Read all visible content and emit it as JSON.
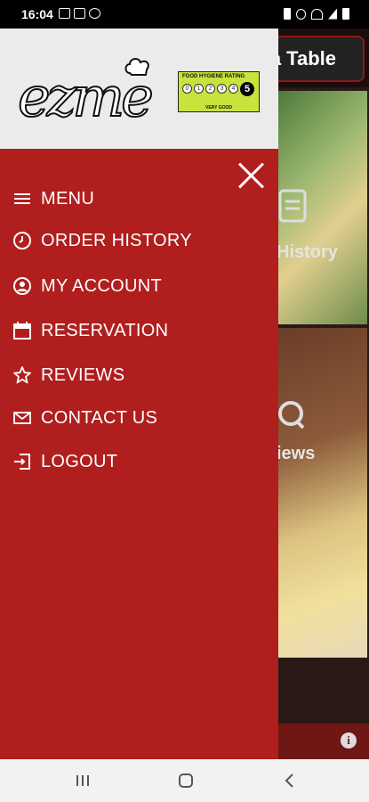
{
  "status_bar": {
    "time": "16:04"
  },
  "background": {
    "header_button": "a Table",
    "tile_history_label": "History",
    "tile_reviews_label": "iews"
  },
  "drawer": {
    "logo_text": "ezme",
    "hygiene_rating": {
      "title": "FOOD HYGIENE RATING",
      "scale": [
        "0",
        "1",
        "2",
        "3",
        "4"
      ],
      "score": "5",
      "caption": "VERY GOOD"
    },
    "menu": [
      {
        "label": "MENU",
        "icon": "hamburger-icon"
      },
      {
        "label": "ORDER HISTORY",
        "icon": "clock-icon"
      },
      {
        "label": "MY ACCOUNT",
        "icon": "user-icon"
      },
      {
        "label": "RESERVATION",
        "icon": "calendar-icon"
      },
      {
        "label": "REVIEWS",
        "icon": "star-icon"
      },
      {
        "label": "CONTACT US",
        "icon": "envelope-icon"
      },
      {
        "label": "LOGOUT",
        "icon": "logout-icon"
      }
    ]
  },
  "colors": {
    "drawer_background": "#b01e1e",
    "header_background": "#ebebeb",
    "hygiene_badge": "#c9e23c"
  }
}
